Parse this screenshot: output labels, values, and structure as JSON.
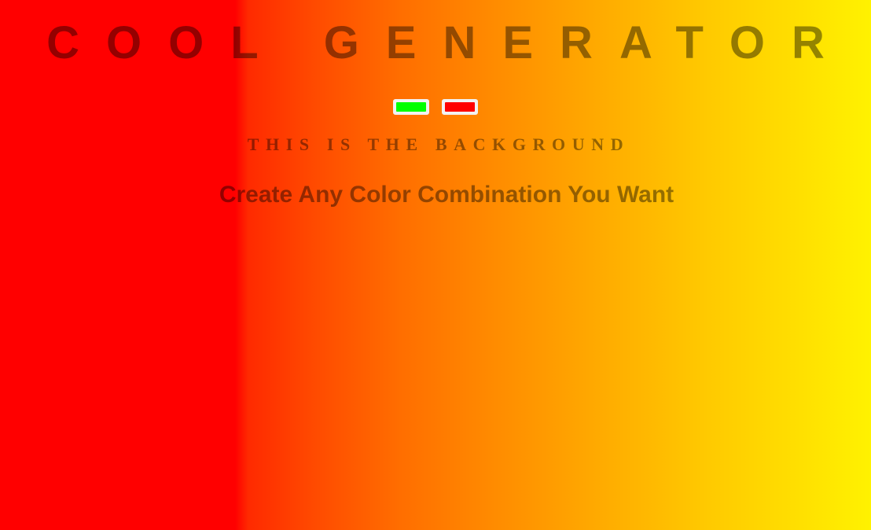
{
  "header": {
    "title": "COOL GENERATOR"
  },
  "pickers": {
    "color1": "#00ff00",
    "color2": "#ff0000"
  },
  "background_label": "THIS IS THE BACKGROUND",
  "subtitle": "Create Any Color Combination You Want"
}
